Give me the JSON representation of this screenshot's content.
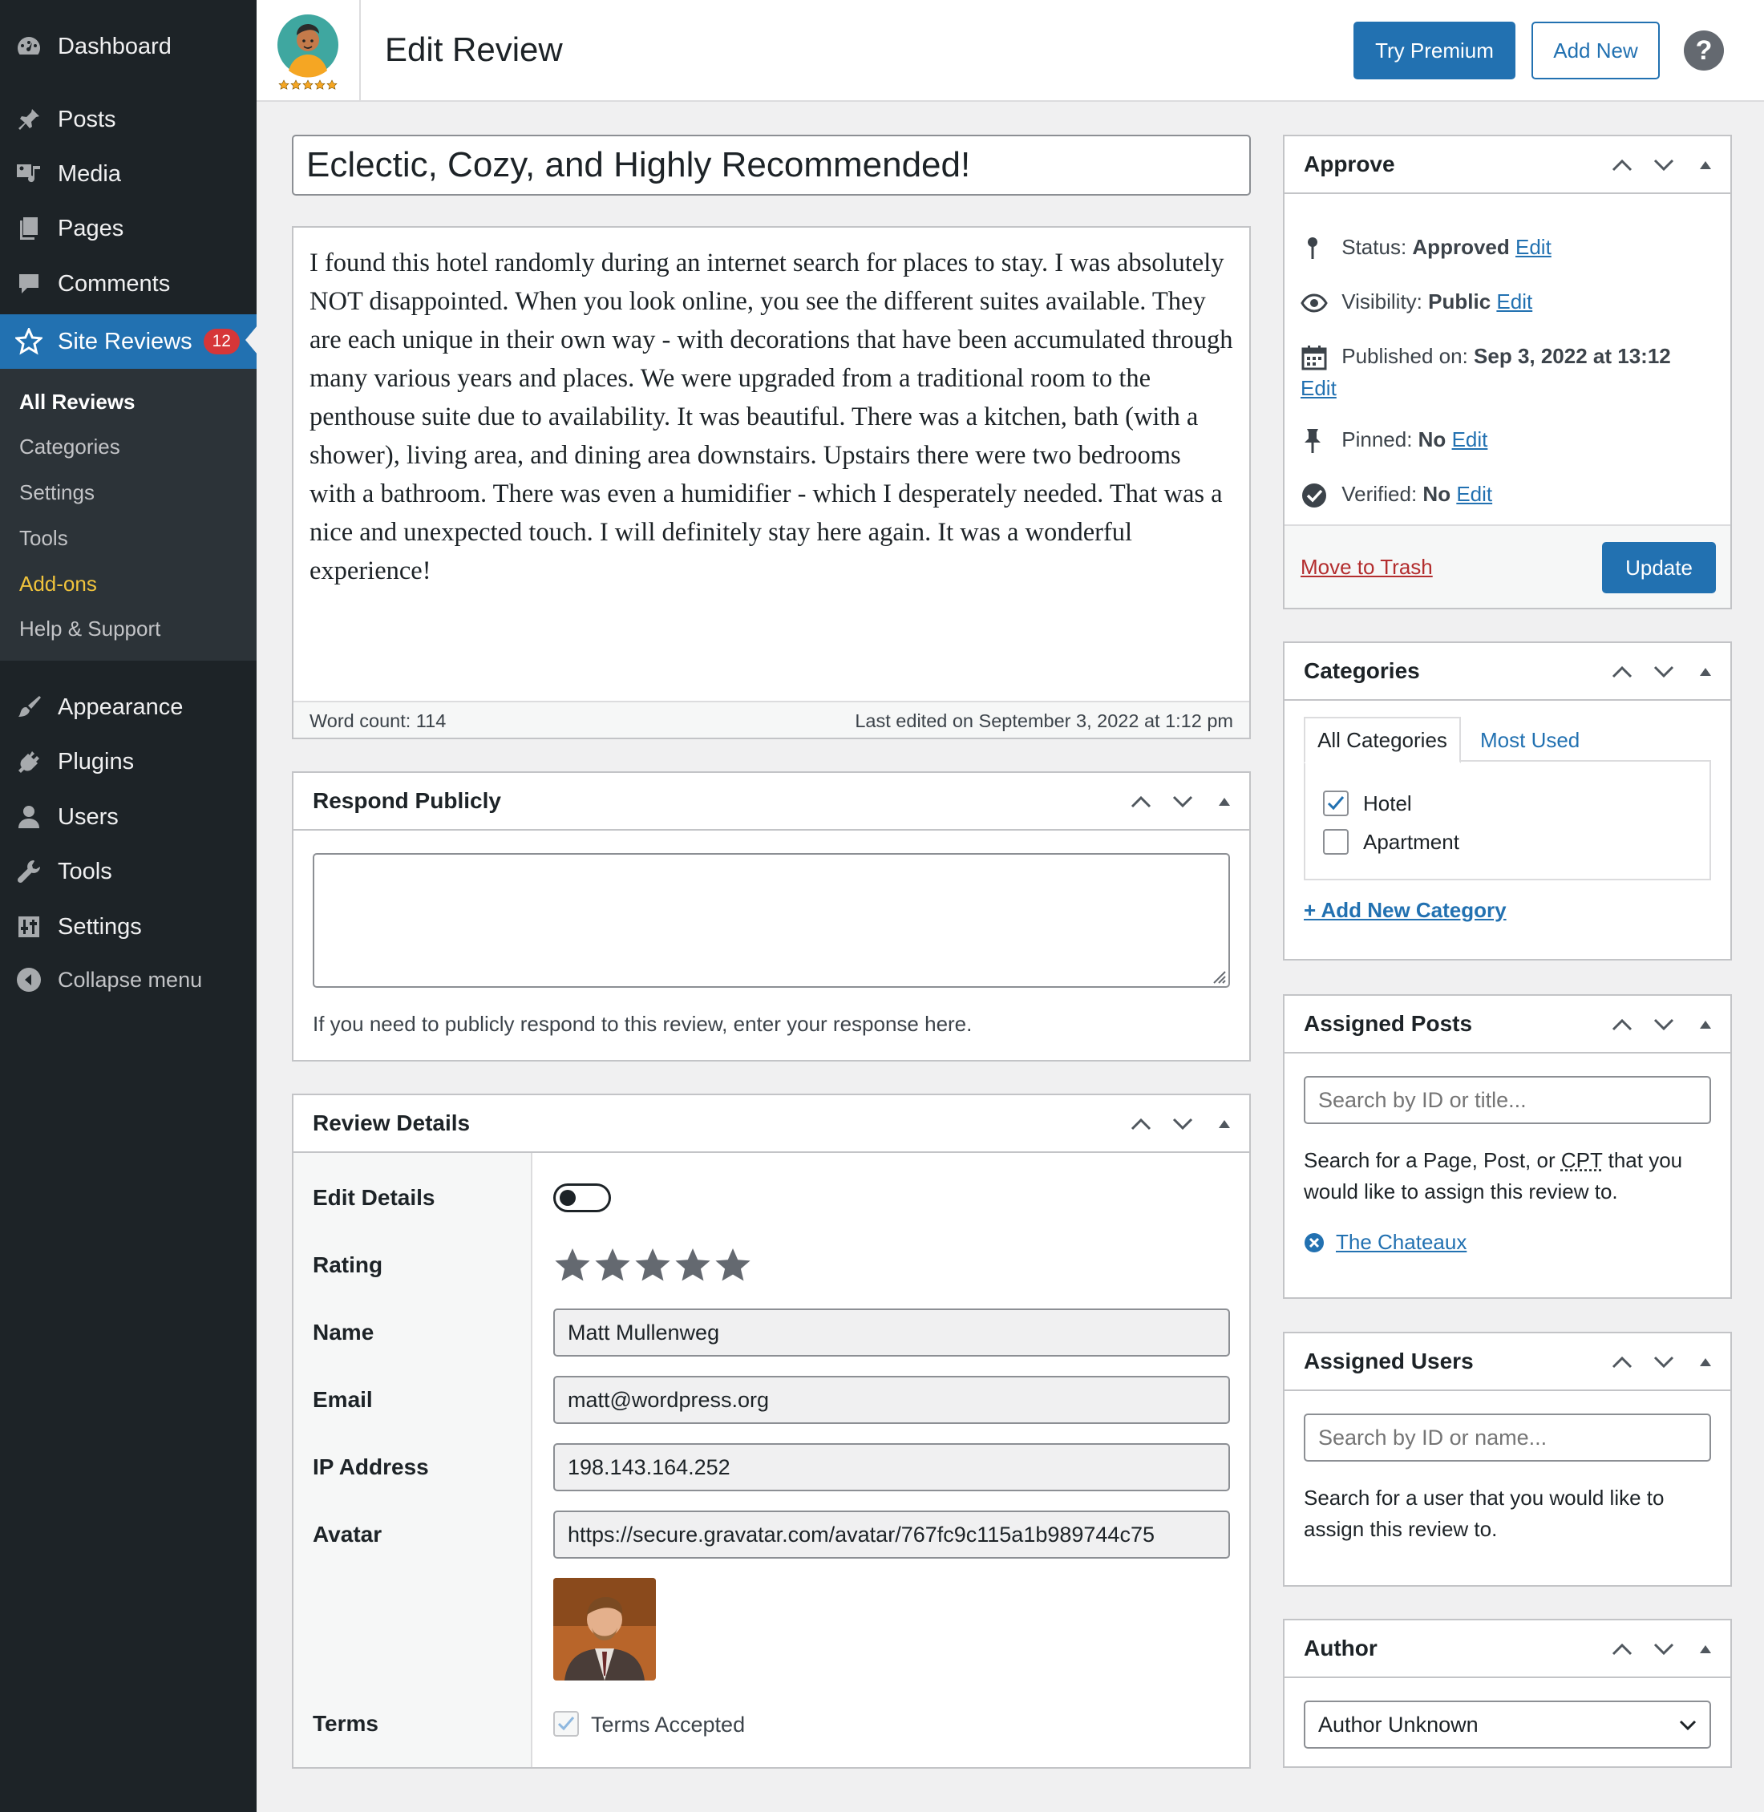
{
  "sidebar": {
    "dashboard": "Dashboard",
    "posts": "Posts",
    "media": "Media",
    "pages": "Pages",
    "comments": "Comments",
    "site_reviews": "Site Reviews",
    "site_reviews_badge": "12",
    "submenu": [
      "All Reviews",
      "Categories",
      "Settings",
      "Tools",
      "Add-ons",
      "Help & Support"
    ],
    "appearance": "Appearance",
    "plugins": "Plugins",
    "users": "Users",
    "tools": "Tools",
    "settings": "Settings",
    "collapse": "Collapse menu"
  },
  "header": {
    "title": "Edit Review",
    "try_premium": "Try Premium",
    "add_new": "Add New",
    "help": "?"
  },
  "review": {
    "title": "Eclectic, Cozy, and Highly Recommended!",
    "content": "I found this hotel randomly during an internet search for places to stay. I was absolutely NOT disappointed. When you look online, you see the different suites available. They are each unique in their own way - with decorations that have been accumulated through many various years and places. We were upgraded from a traditional room to the penthouse suite due to availability. It was beautiful. There was a kitchen, bath (with a shower), living area, and dining area downstairs. Upstairs there were two bedrooms with a bathroom. There was even a humidifier - which I desperately needed. That was a nice and unexpected touch. I will definitely stay here again. It was a wonderful experience!",
    "word_count": "Word count: 114",
    "last_edited": "Last edited on September 3, 2022 at 1:12 pm"
  },
  "respond": {
    "title": "Respond Publicly",
    "help": "If you need to publicly respond to this review, enter your response here."
  },
  "details": {
    "title": "Review Details",
    "labels": {
      "edit_details": "Edit Details",
      "rating": "Rating",
      "name": "Name",
      "email": "Email",
      "ip": "IP Address",
      "avatar": "Avatar",
      "terms": "Terms"
    },
    "rating_stars": 5,
    "name": "Matt Mullenweg",
    "email": "matt@wordpress.org",
    "ip": "198.143.164.252",
    "avatar_url": "https://secure.gravatar.com/avatar/767fc9c115a1b989744c75",
    "terms_label": "Terms Accepted"
  },
  "approve": {
    "title": "Approve",
    "status_label": "Status:",
    "status_value": "Approved",
    "visibility_label": "Visibility:",
    "visibility_value": "Public",
    "published_label": "Published on:",
    "published_value": "Sep 3, 2022 at 13:12",
    "pinned_label": "Pinned:",
    "pinned_value": "No",
    "verified_label": "Verified:",
    "verified_value": "No",
    "edit": "Edit",
    "trash": "Move to Trash",
    "update": "Update"
  },
  "categories": {
    "title": "Categories",
    "tab_all": "All Categories",
    "tab_most": "Most Used",
    "items": [
      {
        "label": "Hotel",
        "checked": true
      },
      {
        "label": "Apartment",
        "checked": false
      }
    ],
    "add_new": "+ Add New Category"
  },
  "assigned_posts": {
    "title": "Assigned Posts",
    "placeholder": "Search by ID or title...",
    "help_pre": "Search for a Page, Post, or",
    "help_cpt": "CPT",
    "help_post": "that you would like to assign this review to.",
    "assigned": "The Chateaux"
  },
  "assigned_users": {
    "title": "Assigned Users",
    "placeholder": "Search by ID or name...",
    "help": "Search for a user that you would like to assign this review to."
  },
  "author": {
    "title": "Author",
    "selected": "Author Unknown"
  },
  "colors": {
    "admin_dark": "#1d2327",
    "submenu_bg": "#2c3338",
    "accent": "#2271b1",
    "badge": "#d63638",
    "addons": "#f0c33c",
    "trash": "#b32d2e"
  }
}
